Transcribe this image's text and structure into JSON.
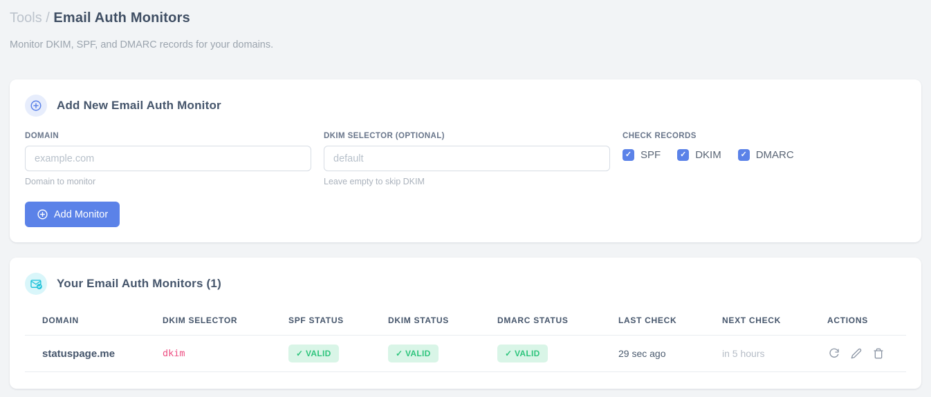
{
  "page": {
    "breadcrumb": {
      "parent": "Tools",
      "separator": "/",
      "current": "Email Auth Monitors"
    },
    "subtitle": "Monitor DKIM, SPF, and DMARC records for your domains."
  },
  "add_monitor_card": {
    "title": "Add New Email Auth Monitor",
    "fields": {
      "domain": {
        "label": "DOMAIN",
        "value": "",
        "placeholder": "example.com",
        "helper": "Domain to monitor"
      },
      "dkim_selector": {
        "label": "DKIM SELECTOR (OPTIONAL)",
        "value": "",
        "placeholder": "default",
        "helper": "Leave empty to skip DKIM"
      }
    },
    "check_records": {
      "label": "CHECK RECORDS",
      "options": [
        {
          "label": "SPF",
          "checked": true
        },
        {
          "label": "DKIM",
          "checked": true
        },
        {
          "label": "DMARC",
          "checked": true
        }
      ]
    },
    "submit_label": "Add Monitor"
  },
  "monitors_card": {
    "title": "Your Email Auth Monitors (1)",
    "count": 1,
    "table": {
      "headers": [
        "DOMAIN",
        "DKIM SELECTOR",
        "SPF STATUS",
        "DKIM STATUS",
        "DMARC STATUS",
        "LAST CHECK",
        "NEXT CHECK",
        "ACTIONS"
      ],
      "rows": [
        {
          "domain": "statuspage.me",
          "dkim_selector": "dkim",
          "spf_status": "✓ VALID",
          "dkim_status": "✓ VALID",
          "dmarc_status": "✓ VALID",
          "last_check": "29 sec ago",
          "next_check": "in 5 hours",
          "actions": [
            "refresh",
            "edit",
            "delete"
          ]
        }
      ]
    }
  },
  "icons": {
    "add_card": "plus-circle-icon",
    "list_card": "envelope-check-icon",
    "checkbox": "checkmark",
    "check_glyph": "✓"
  },
  "colors": {
    "accent_blue": "#5b82e8",
    "accent_cyan": "#22c3da",
    "badge_green_bg": "#d9f5e7",
    "badge_green_text": "#2fc57d",
    "code_pink": "#ed4f82",
    "page_bg": "#f2f4f6"
  }
}
